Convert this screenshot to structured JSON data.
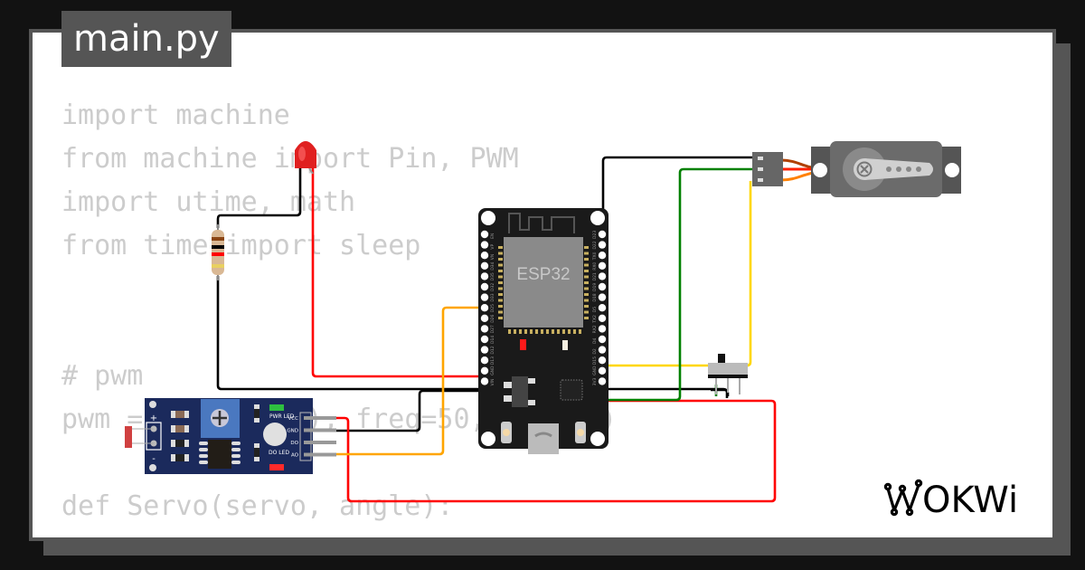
{
  "tab": {
    "filename": "main.py"
  },
  "code": {
    "lines": [
      "import machine",
      "from machine import Pin, PWM",
      "import utime, math",
      "from time import sleep",
      "",
      "",
      "# pwm",
      "pwm = PWM(Pin(2), freq=50, duty=0)",
      "",
      "def Servo(servo, angle):"
    ]
  },
  "diagram": {
    "esp32": {
      "label": "ESP32",
      "left_pins": [
        "EN",
        "VP",
        "VN",
        "D34",
        "D35",
        "D32",
        "D33",
        "D25",
        "D26",
        "D27",
        "D14",
        "D12",
        "D13",
        "GND",
        "VIN"
      ],
      "right_pins": [
        "D23",
        "D22",
        "TX0",
        "RX0",
        "D21",
        "D19",
        "D18",
        "D5",
        "TX2",
        "RX2",
        "D4",
        "D2",
        "D15",
        "GND",
        "3V3"
      ]
    },
    "sensor_module": {
      "pins": [
        "VCC",
        "GND",
        "DO",
        "AO"
      ],
      "pwr_led_label": "PWR LED",
      "do_led_label": "DO LED",
      "plus_label": "+",
      "minus_label": "-"
    },
    "wire_colors": {
      "black": "#000000",
      "red": "#ff0000",
      "green": "#008000",
      "yellow": "#ffd700",
      "orange": "#ffa500"
    }
  },
  "brand": {
    "logo_text": "WOKWI"
  }
}
